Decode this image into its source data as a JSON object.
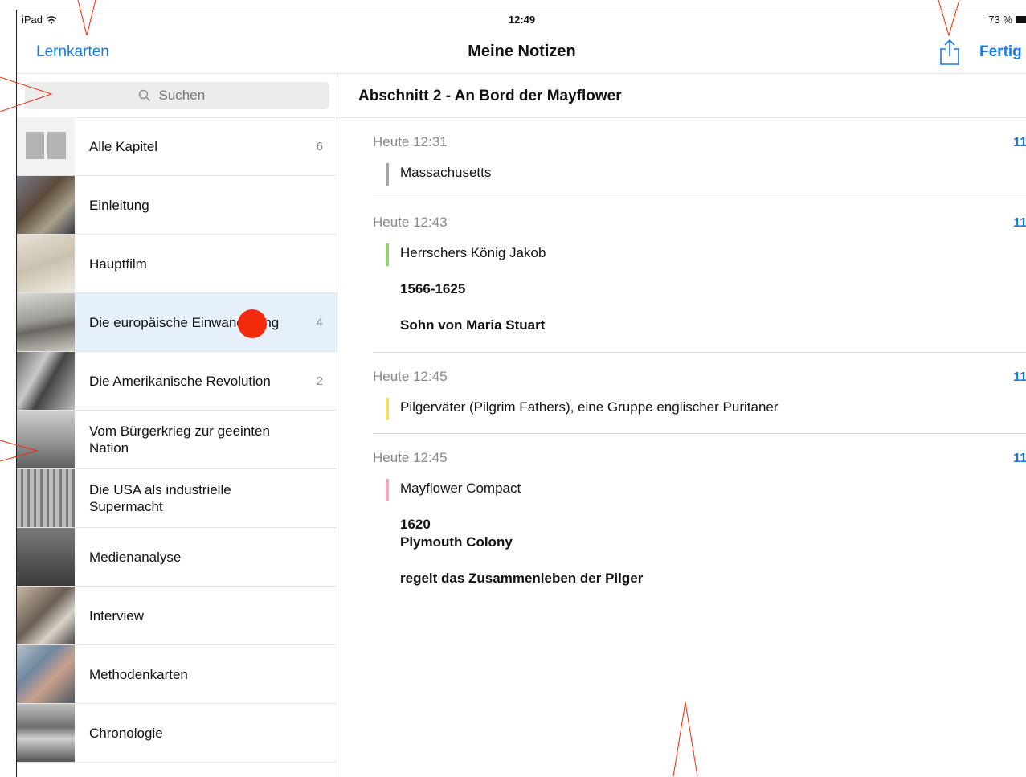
{
  "status_bar": {
    "device": "iPad",
    "time": "12:49",
    "battery": "73 %"
  },
  "nav": {
    "back_label": "Lernkarten",
    "title": "Meine Notizen",
    "done_label": "Fertig"
  },
  "search": {
    "placeholder": "Suchen"
  },
  "chapters": [
    {
      "label": "Alle Kapitel",
      "count": "6"
    },
    {
      "label": "Einleitung",
      "count": ""
    },
    {
      "label": "Hauptfilm",
      "count": ""
    },
    {
      "label": "Die europäische Einwanderung",
      "count": "4"
    },
    {
      "label": "Die Amerikanische Revolution",
      "count": "2"
    },
    {
      "label": "Vom Bürgerkrieg zur geeinten Nation",
      "count": ""
    },
    {
      "label": "Die USA als industrielle Supermacht",
      "count": ""
    },
    {
      "label": "Medienanalyse",
      "count": ""
    },
    {
      "label": "Interview",
      "count": ""
    },
    {
      "label": "Methodenkarten",
      "count": ""
    },
    {
      "label": "Chronologie",
      "count": ""
    }
  ],
  "section": {
    "title": "Abschnitt 2 - An Bord der Mayflower"
  },
  "notes": [
    {
      "time": "Heute 12:31",
      "page": "11",
      "marker_color": "#a6a6a6",
      "lines": [
        "Massachusetts"
      ]
    },
    {
      "time": "Heute 12:43",
      "page": "11",
      "marker_color": "#8fd36a",
      "lines": [
        "Herrschers König Jakob",
        "1566-1625",
        "Sohn von Maria Stuart"
      ]
    },
    {
      "time": "Heute 12:45",
      "page": "11",
      "marker_color": "#f3df63",
      "lines": [
        "Pilgerväter (Pilgrim Fathers), eine Gruppe englischer Puritaner"
      ]
    },
    {
      "time": "Heute 12:45",
      "page": "11",
      "marker_color": "#f2a6c0",
      "lines": [
        "Mayflower Compact",
        "1620",
        "Plymouth Colony",
        "regelt das Zusammenleben der Pilger"
      ]
    }
  ],
  "colors": {
    "accent": "#1a7ae0",
    "selection": "#e6f0fb",
    "annotation": "#f02a0a"
  }
}
